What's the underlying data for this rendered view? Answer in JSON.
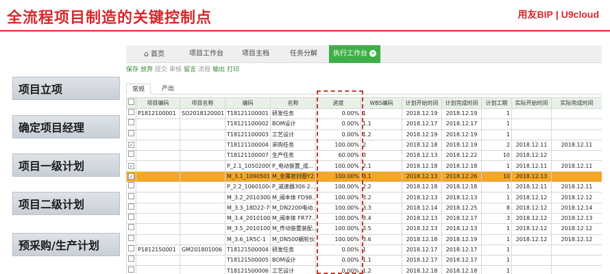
{
  "slide": {
    "title": "全流程项目制造的关键控制点",
    "brand_left": "用友BIP",
    "brand_sep": "|",
    "brand_right": "U9cloud",
    "accent_color": "#d8262b"
  },
  "steps": [
    "项目立项",
    "确定项目经理",
    "项目一级计划",
    "项目二级计划",
    "预采购/生产计划"
  ],
  "nav": {
    "home_icon": "home-icon",
    "items": [
      "首页",
      "项目工作台",
      "项目主档",
      "任务分解",
      "执行工作台"
    ],
    "close_glyph": "×"
  },
  "toolbar": {
    "items": [
      {
        "label": "保存",
        "state": "active"
      },
      {
        "label": "放弃",
        "state": "active"
      },
      {
        "label": "提交",
        "state": "muted"
      },
      {
        "label": "审核",
        "state": "muted"
      },
      {
        "label": "留言",
        "state": "active"
      },
      {
        "label": "流程",
        "state": "muted"
      },
      {
        "label": "输出",
        "state": "active"
      },
      {
        "label": "打印",
        "state": "active"
      }
    ]
  },
  "tabs": [
    "常规",
    "产出"
  ],
  "grid": {
    "columns": [
      "",
      "项目编码",
      "项目名称",
      "编码",
      "名称",
      "进度",
      "WBS编码",
      "计划开始时间",
      "计划完成时间",
      "计划工期",
      "实际开始时间",
      "实际完成时间"
    ],
    "rows": [
      {
        "checked": false,
        "project_code": "P1812100001",
        "project_name": "SO2018120001",
        "code": "T18121100001",
        "name": "研发任务",
        "progress": "0.00%",
        "wbs": "1",
        "plan_start": "2018.12.19",
        "plan_end": "2018.12.19",
        "duration": "1",
        "act_start": "",
        "act_end": ""
      },
      {
        "checked": false,
        "project_code": "",
        "project_name": "",
        "code": "T18121100002",
        "name": "BOM设计",
        "progress": "0.00%",
        "wbs": "1.1",
        "plan_start": "2018.12.17",
        "plan_end": "2018.12.17",
        "duration": "1",
        "act_start": "",
        "act_end": ""
      },
      {
        "checked": false,
        "project_code": "",
        "project_name": "",
        "code": "T18121100003",
        "name": "工艺设计",
        "progress": "0.00%",
        "wbs": "1.2",
        "plan_start": "2018.12.19",
        "plan_end": "2018.12.19",
        "duration": "1",
        "act_start": "",
        "act_end": ""
      },
      {
        "checked": true,
        "project_code": "",
        "project_name": "",
        "code": "T18121100004",
        "name": "采购任务",
        "progress": "100.00%",
        "wbs": "2",
        "plan_start": "2018.12.18",
        "plan_end": "2018.12.19",
        "duration": "2",
        "act_start": "2018.12.11",
        "act_end": "2018.12.11"
      },
      {
        "checked": false,
        "project_code": "",
        "project_name": "",
        "code": "T18121100007",
        "name": "生产任务",
        "progress": "60.00%",
        "wbs": "3",
        "plan_start": "2018.12.13",
        "plan_end": "2018.12.22",
        "duration": "10",
        "act_start": "2018.12.12",
        "act_end": ""
      },
      {
        "checked": true,
        "project_code": "",
        "project_name": "",
        "code": "P_2.1_10502009...",
        "name": "P_电动装置_成...",
        "progress": "100.00%",
        "wbs": "2.1",
        "plan_start": "2018.12.18",
        "plan_end": "2018.12.18",
        "duration": "1",
        "act_start": "2018.12.11",
        "act_end": "2018.12.11"
      },
      {
        "checked": true,
        "highlight": true,
        "project_code": "",
        "project_name": "",
        "code": "M_3.1_1090501...",
        "name": "M_金属密封圈Y2...",
        "progress": "100.00%",
        "wbs": "3.1",
        "plan_start": "2018.12.13",
        "plan_end": "2018.12.26",
        "duration": "10",
        "act_start": "2018.12.13",
        "act_end": ""
      },
      {
        "checked": false,
        "project_code": "",
        "project_name": "",
        "code": "P_2.2_10601004...",
        "name": "P_减速器30II-2...",
        "progress": "100.00%",
        "wbs": "2.2",
        "plan_start": "2018.12.18",
        "plan_end": "2018.12.18",
        "duration": "1",
        "act_start": "2018.12.11",
        "act_end": "2018.12.11"
      },
      {
        "checked": false,
        "project_code": "",
        "project_name": "",
        "code": "M_3.2_2010300...",
        "name": "M_阀本体 FD98...",
        "progress": "100.00%",
        "wbs": "3.2",
        "plan_start": "2018.12.13",
        "plan_end": "2018.12.13",
        "duration": "1",
        "act_start": "2018.12.12",
        "act_end": "2018.12.12"
      },
      {
        "checked": false,
        "project_code": "",
        "project_name": "",
        "code": "M_3.3_18D22-7U",
        "name": "M_DN2200电动...",
        "progress": "100.00%",
        "wbs": "3.3",
        "plan_start": "2018.12.14",
        "plan_end": "2018.12.25",
        "duration": "8",
        "act_start": "2018.12.12",
        "act_end": "2018.12.14"
      },
      {
        "checked": false,
        "project_code": "",
        "project_name": "",
        "code": "M_3.4_2010100...",
        "name": "M_阀本体 FR77...",
        "progress": "100.00%",
        "wbs": "3.4",
        "plan_start": "2018.12.13",
        "plan_end": "2018.12.17",
        "duration": "3",
        "act_start": "2018.12.12",
        "act_end": "2018.12.13"
      },
      {
        "checked": false,
        "project_code": "",
        "project_name": "",
        "code": "M_3.5_2010100...",
        "name": "M_传动装置装配...",
        "progress": "100.00%",
        "wbs": "3.5",
        "plan_start": "2018.12.13",
        "plan_end": "2018.12.13",
        "duration": "1",
        "act_start": "2018.12.12",
        "act_end": "2018.12.12"
      },
      {
        "checked": false,
        "project_code": "",
        "project_name": "",
        "code": "M_3.6_1R5C-1",
        "name": "M_DN500蜗轮伙...",
        "progress": "100.00%",
        "wbs": "3.6",
        "plan_start": "2018.12.18",
        "plan_end": "2018.12.19",
        "duration": "1",
        "act_start": "2018.12.12",
        "act_end": "2018.12.12"
      },
      {
        "checked": false,
        "project_code": "P1812150001",
        "project_name": "GM201801006",
        "code": "T18121500004",
        "name": "研发任务",
        "progress": "0.00%",
        "wbs": "1",
        "plan_start": "2018.12.17",
        "plan_end": "2018.12.17",
        "duration": "1",
        "act_start": "",
        "act_end": ""
      },
      {
        "checked": false,
        "project_code": "",
        "project_name": "",
        "code": "T18121500005",
        "name": "BOM设计",
        "progress": "0.00%",
        "wbs": "1.1",
        "plan_start": "2018.12.17",
        "plan_end": "2018.12.17",
        "duration": "1",
        "act_start": "",
        "act_end": ""
      },
      {
        "checked": false,
        "project_code": "",
        "project_name": "",
        "code": "T18121500006",
        "name": "工艺设计",
        "progress": "0.00%",
        "wbs": "1.2",
        "plan_start": "2018.12.18",
        "plan_end": "2018.12.18",
        "duration": "1",
        "act_start": "",
        "act_end": ""
      }
    ]
  }
}
